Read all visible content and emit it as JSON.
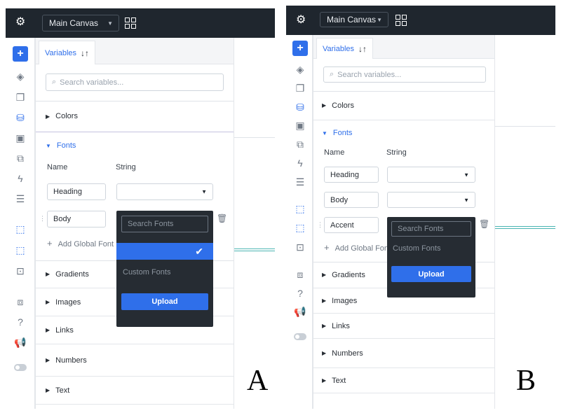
{
  "panels": [
    {
      "id": "A",
      "canvas_label": "Main Canvas",
      "tab_label": "Variables",
      "search_placeholder": "Search variables...",
      "open_section": "Fonts",
      "col_name": "Name",
      "col_type": "String",
      "rows": [
        "Heading",
        "Body"
      ],
      "add_label": "Add Global Font",
      "dropdown": {
        "search_placeholder": "Search Fonts",
        "selected_check": "✔",
        "custom_label": "Custom Fonts",
        "upload_label": "Upload"
      },
      "sections_top": [
        "Colors"
      ],
      "sections_bottom": [
        "Gradients",
        "Images",
        "Links",
        "Numbers",
        "Text"
      ],
      "letter": "A"
    },
    {
      "id": "B",
      "canvas_label": "Main Canvas",
      "tab_label": "Variables",
      "search_placeholder": "Search variables...",
      "open_section": "Fonts",
      "col_name": "Name",
      "col_type": "String",
      "rows": [
        "Heading",
        "Body",
        "Accent"
      ],
      "add_label": "Add Global Font",
      "dropdown": {
        "search_placeholder": "Search Fonts",
        "custom_label": "Custom Fonts",
        "upload_label": "Upload"
      },
      "sections_top": [
        "Colors"
      ],
      "sections_bottom": [
        "Gradients",
        "Images",
        "Links",
        "Numbers",
        "Text"
      ],
      "letter": "B"
    }
  ],
  "icons": {
    "settings": "⚙",
    "add": "+",
    "sort": "↓↑",
    "search": "⌕",
    "triangle_closed": "▶",
    "triangle_open": "▼",
    "caret": "▼",
    "drag": "⋮⋮",
    "trash": "🗑",
    "add_small": "+"
  },
  "colors": {
    "accent": "#2f6fea",
    "topbar": "#1f262e",
    "dropdown": "#262c33",
    "connector": "#4ab5b2"
  }
}
